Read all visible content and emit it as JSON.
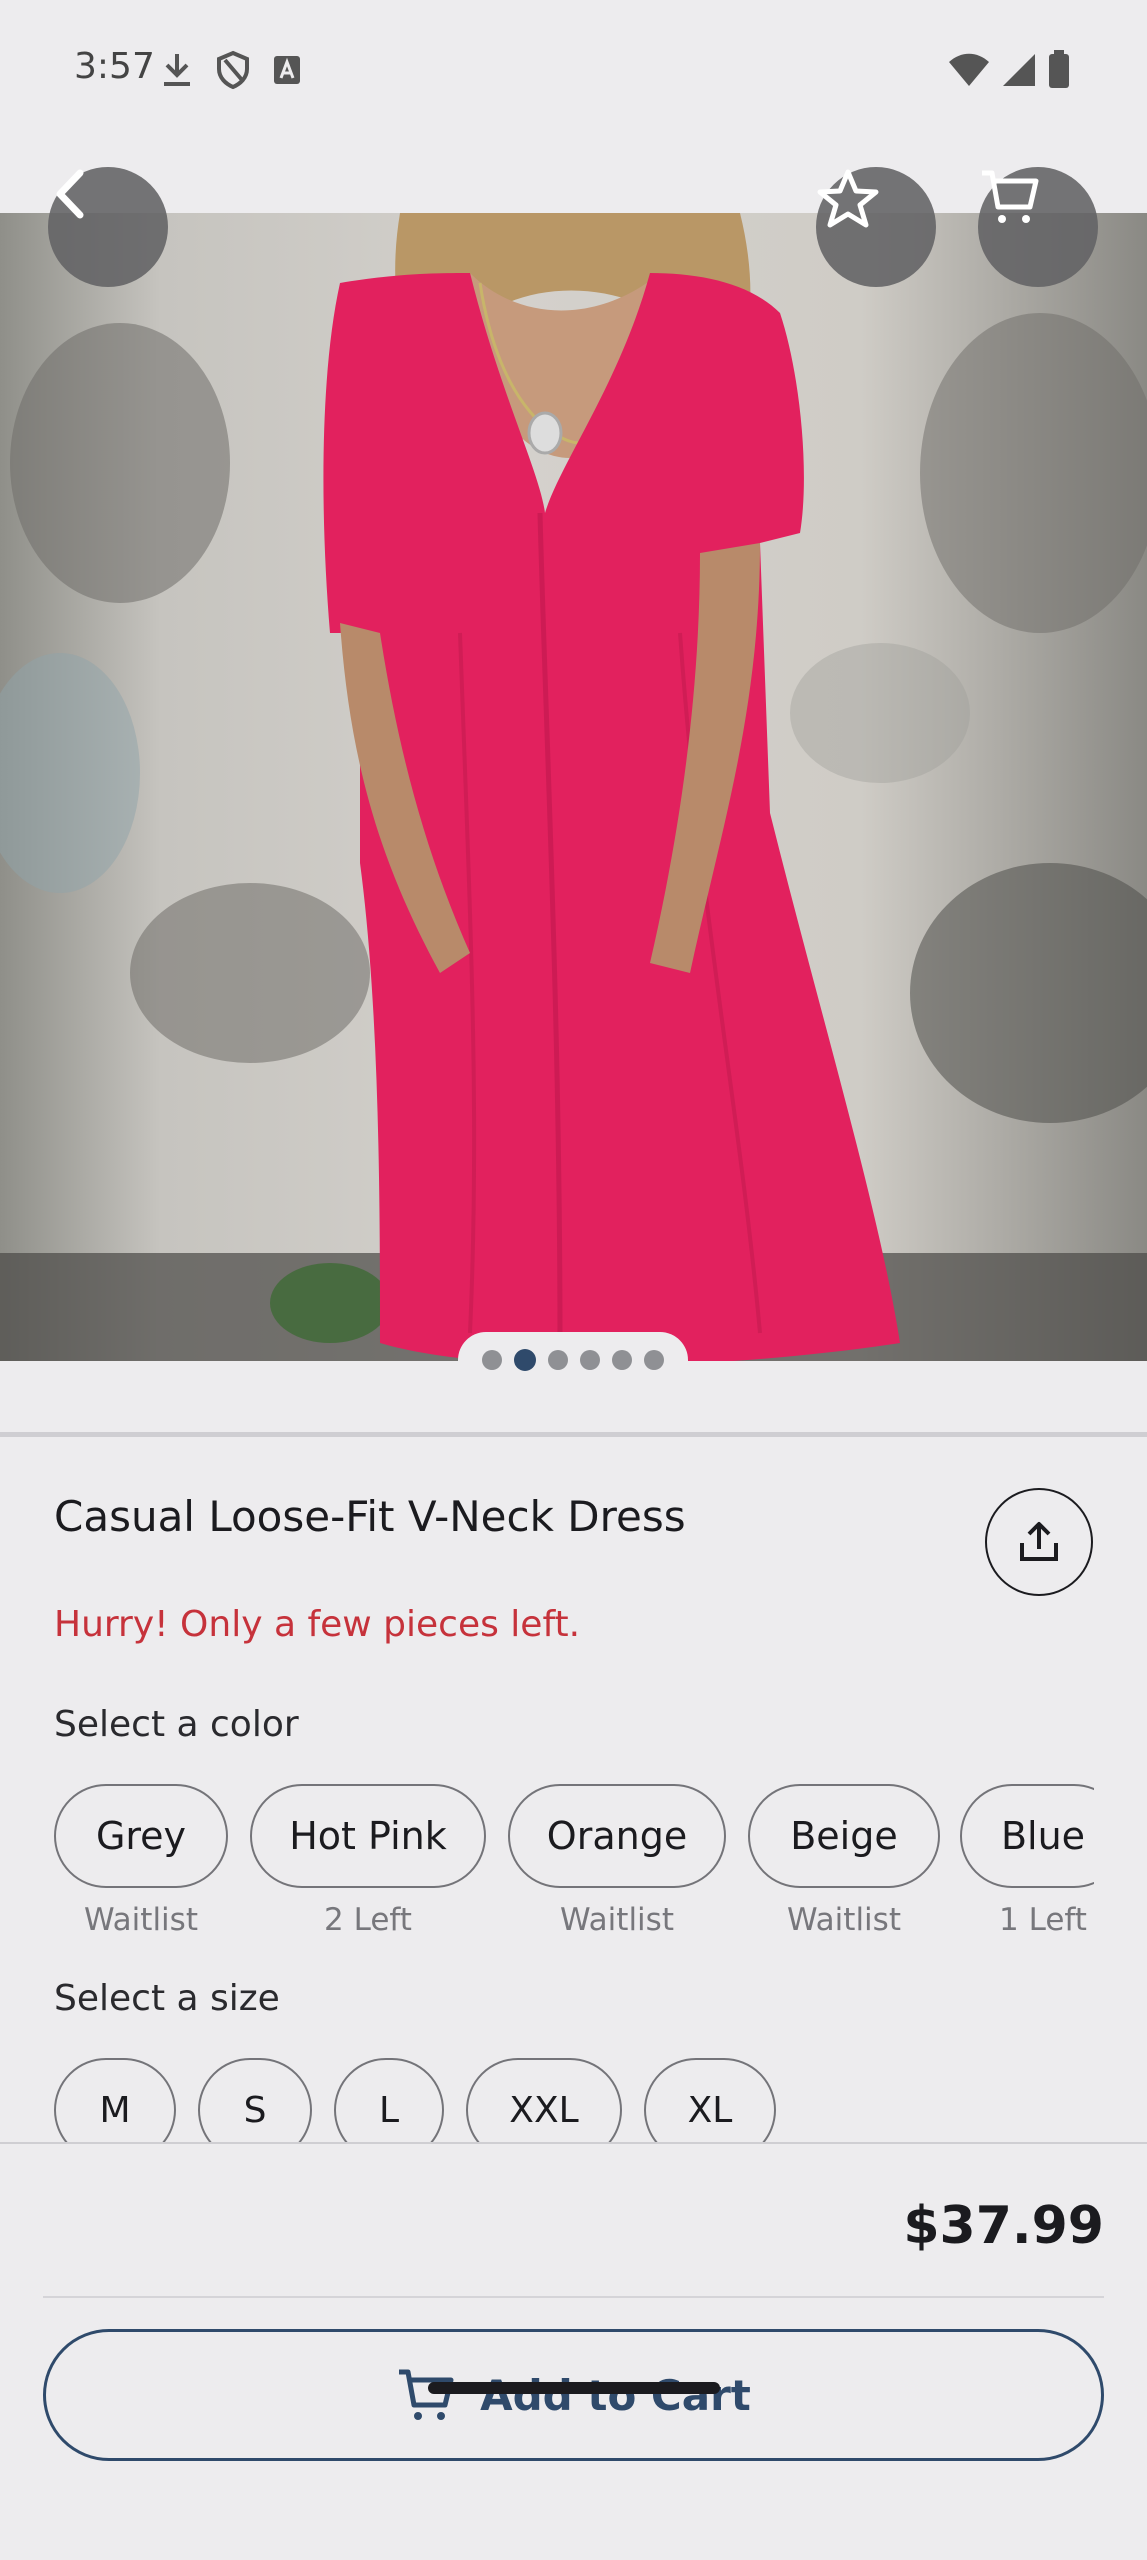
{
  "status_bar": {
    "time": "3:57",
    "left_icons": [
      "download-icon",
      "shield-icon",
      "font-icon"
    ],
    "right_icons": [
      "wifi-icon",
      "signal-icon",
      "battery-icon"
    ]
  },
  "hero": {
    "image_subject": "product-photo",
    "pager": {
      "count": 6,
      "active_index": 1
    }
  },
  "top_actions": {
    "back_icon": "chevron-left-icon",
    "favorite_icon": "star-icon",
    "cart_icon": "cart-icon"
  },
  "product": {
    "title": "Casual Loose-Fit V-Neck Dress",
    "stock_warning": "Hurry! Only a few pieces left.",
    "share_icon": "share-icon"
  },
  "color_section": {
    "label": "Select a color",
    "options": [
      {
        "name": "Grey",
        "availability": "Waitlist"
      },
      {
        "name": "Hot Pink",
        "availability": "2 Left"
      },
      {
        "name": "Orange",
        "availability": "Waitlist"
      },
      {
        "name": "Beige",
        "availability": "Waitlist"
      },
      {
        "name": "Blue",
        "availability": "1 Left"
      }
    ]
  },
  "size_section": {
    "label": "Select a size",
    "options": [
      "M",
      "S",
      "L",
      "XXL",
      "XL"
    ]
  },
  "purchase": {
    "price": "$37.99",
    "add_to_cart_label": "Add to Cart"
  },
  "colors": {
    "accent": "#2f4a6b",
    "warning": "#c6323b",
    "background": "#edecee"
  }
}
